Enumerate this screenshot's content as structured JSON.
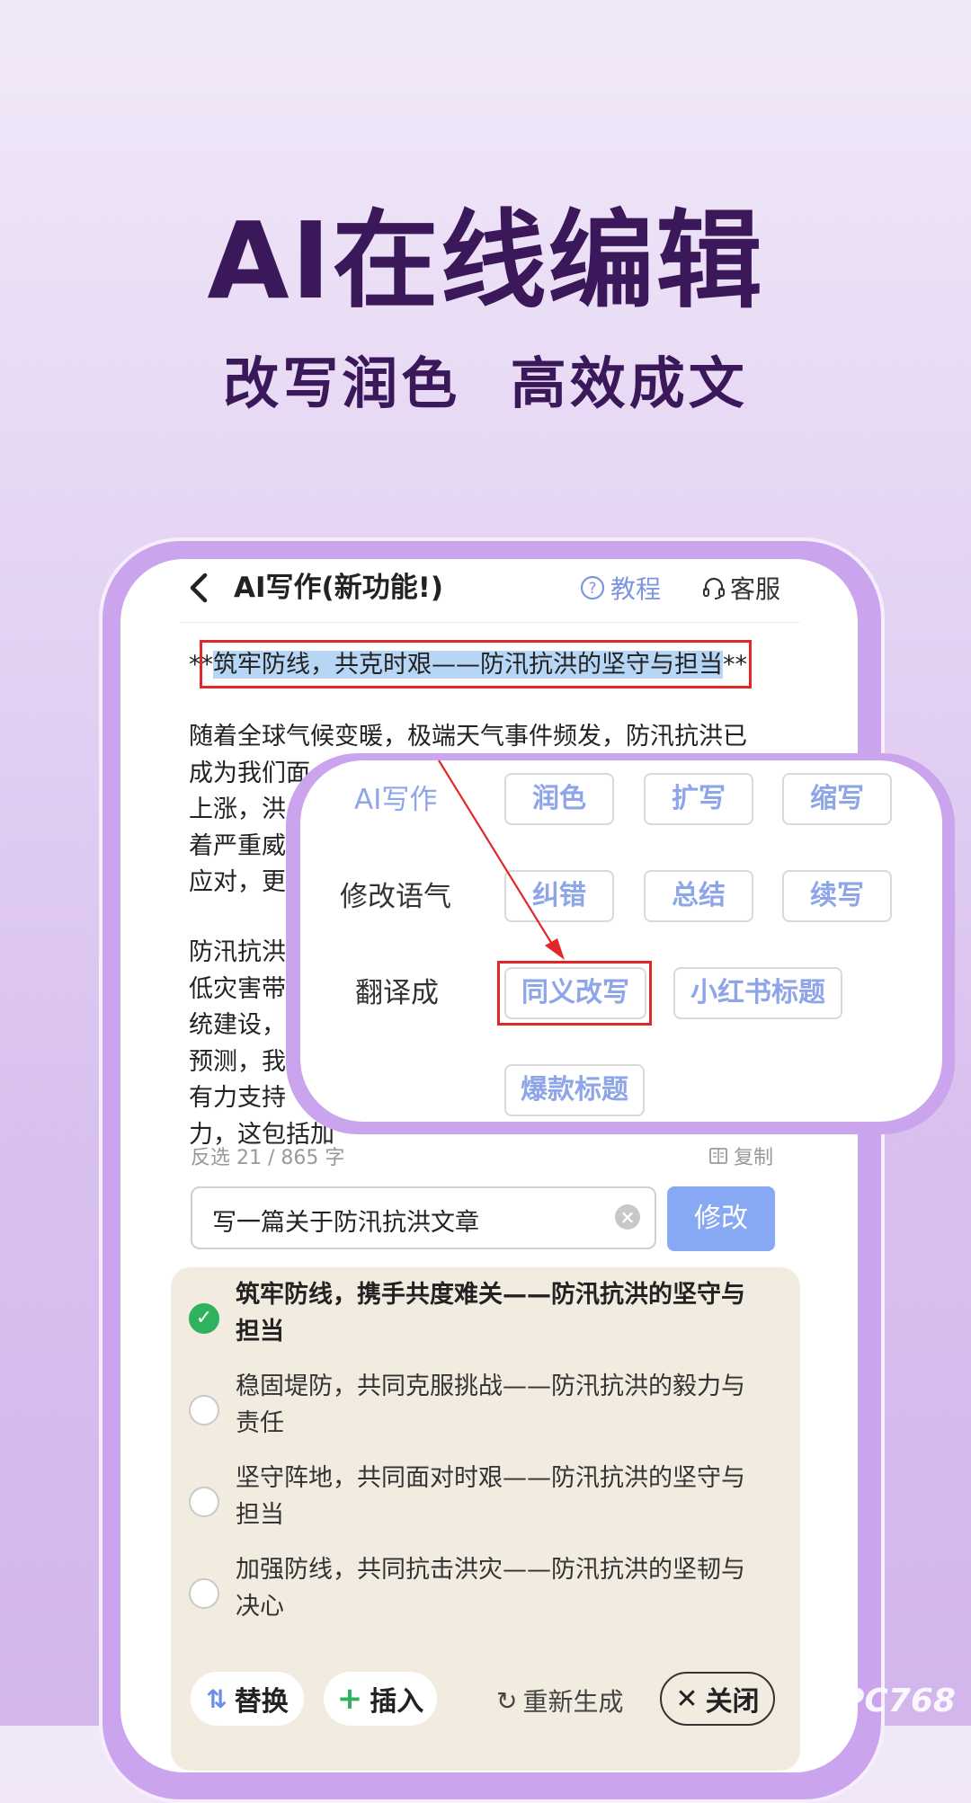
{
  "hero": {
    "title": "AI在线编辑",
    "subtitle": "改写润色  高效成文"
  },
  "header": {
    "back_icon": "chevron-left-icon",
    "title": "AI写作(新功能!)",
    "tutorial_label": "教程",
    "service_label": "客服"
  },
  "document": {
    "title_prefix": "**",
    "title_highlight": "筑牢防线，共克时艰——防汛抗洪的坚守与担当",
    "title_suffix": "**",
    "para1": [
      "随着全球气候变暖，极端天气事件频发，防汛抗洪已",
      "成为我们面",
      "上涨，洪",
      "着严重威",
      "应对，更"
    ],
    "para2": [
      "防汛抗洪",
      "低灾害带",
      "统建设，",
      "预测，我",
      "有力支持",
      "力，这包括加"
    ]
  },
  "counter": "反选 21 / 865 字",
  "copy_label": "复制",
  "input": {
    "value": "写一篇关于防汛抗洪文章",
    "submit_label": "修改"
  },
  "results": [
    {
      "text_line1": "筑牢防线，携手共度难关——防汛抗洪的坚守与",
      "text_line2": "担当",
      "selected": true
    },
    {
      "text_line1": "稳固堤防，共同克服挑战——防汛抗洪的毅力与",
      "text_line2": "责任",
      "selected": false
    },
    {
      "text_line1": "坚守阵地，共同面对时艰——防汛抗洪的坚守与",
      "text_line2": "担当",
      "selected": false
    },
    {
      "text_line1": "加强防线，共同抗击洪灾——防汛抗洪的坚韧与",
      "text_line2": "决心",
      "selected": false
    }
  ],
  "actions": {
    "swap_label": "替换",
    "insert_label": "插入",
    "regenerate_label": "重新生成",
    "close_label": "关闭"
  },
  "popup": {
    "label_ai": "AI写作",
    "label_tone": "修改语气",
    "label_translate": "翻译成",
    "options": [
      "润色",
      "扩写",
      "缩写",
      "纠错",
      "总结",
      "续写",
      "同义改写",
      "小红书标题",
      "爆款标题"
    ]
  },
  "watermark": "PC768",
  "colors": {
    "accent": "#87a8f2",
    "option_text": "#8ea5e8",
    "highlight": "#e12727",
    "frame": "#caa5ee",
    "heading": "#3b1859",
    "success": "#2fb25d"
  }
}
